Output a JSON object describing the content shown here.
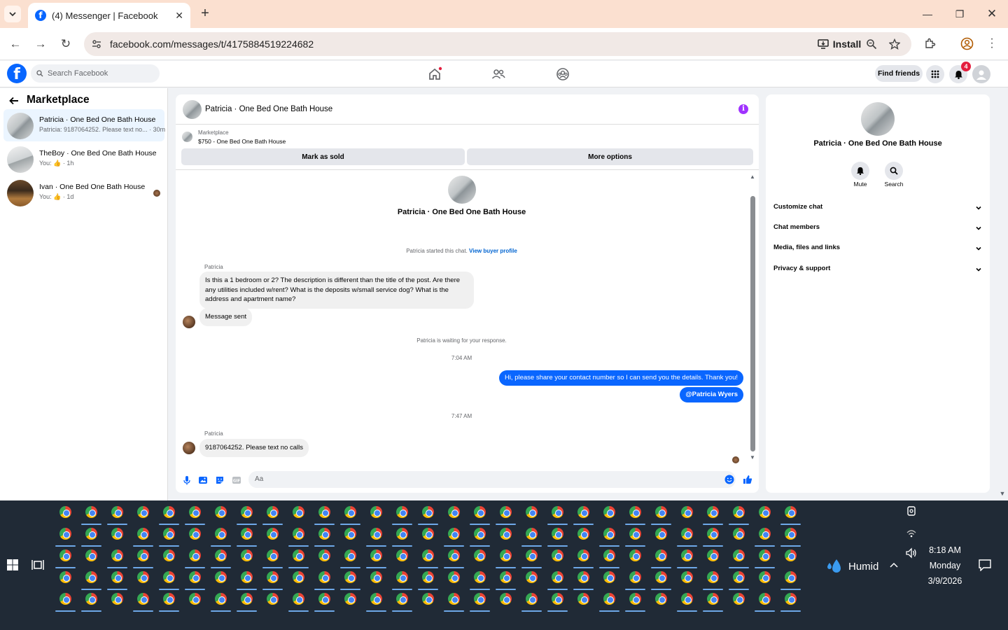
{
  "browser": {
    "tab_title": "(4) Messenger | Facebook",
    "url": "facebook.com/messages/t/4175884519224682",
    "install_label": "Install"
  },
  "header": {
    "search_placeholder": "Search Facebook",
    "find_friends": "Find friends",
    "notification_count": "4",
    "brand_color": "#0866ff"
  },
  "sidebar": {
    "title": "Marketplace",
    "conversations": [
      {
        "title": "Patricia · One Bed One Bath House",
        "preview": "Patricia: 9187064252. Please text no... · 30m",
        "active": true
      },
      {
        "title": "TheBoy · One Bed One Bath House",
        "preview": "You: 👍 · 1h",
        "active": false
      },
      {
        "title": "Ivan · One Bed One Bath House",
        "preview": "You: 👍 · 1d",
        "active": false
      }
    ]
  },
  "chat": {
    "title": "Patricia · One Bed One Bath House",
    "listing_label": "Marketplace",
    "listing_price": "$750 - One Bed One Bath House",
    "mark_sold": "Mark as sold",
    "more_options": "More options",
    "big_title": "Patricia · One Bed One Bath House",
    "started_text": "Patricia started this chat.",
    "view_profile": "View buyer profile",
    "messages": {
      "sender1": "Patricia",
      "msg1": "Is this a 1 bedroom or 2?   The description is different than the title of the post.  Are there any utilities included w/rent?  What is the deposits w/small service dog?  What is the address and apartment name?",
      "msg2": "Message sent",
      "waiting": "Patricia is waiting for your response.",
      "time1": "7:04 AM",
      "me1": "Hi, please share your contact number so I can send you the details. Thank you!",
      "me2": "@Patricia Wyers",
      "time2": "7:47 AM",
      "sender2": "Patricia",
      "msg3": "9187064252.  Please text no calls"
    },
    "input_placeholder": "Aa",
    "accent_color": "#0a66ff"
  },
  "info_panel": {
    "title": "Patricia · One Bed One Bath House",
    "mute": "Mute",
    "search": "Search",
    "sections": [
      "Customize chat",
      "Chat members",
      "Media, files and links",
      "Privacy & support"
    ]
  },
  "taskbar": {
    "weather": "Humid",
    "time": "8:18 AM",
    "day": "Monday",
    "date": "3/9/2026"
  }
}
